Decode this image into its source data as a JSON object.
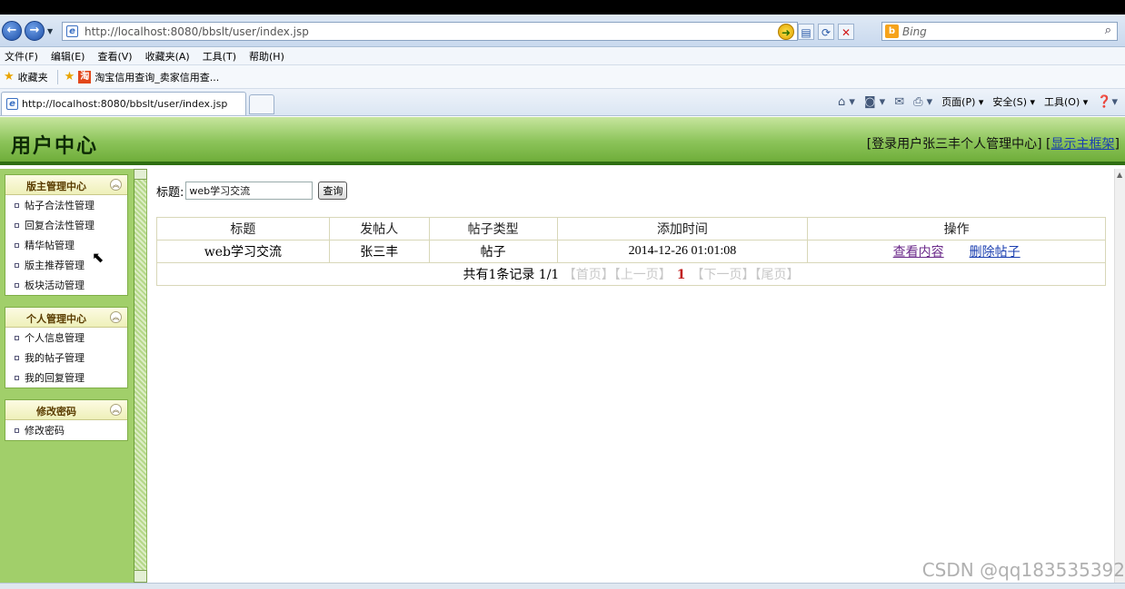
{
  "browser": {
    "url": "http://localhost:8080/bbslt/user/index.jsp",
    "search_provider": "Bing",
    "menu": [
      "文件(F)",
      "编辑(E)",
      "查看(V)",
      "收藏夹(A)",
      "工具(T)",
      "帮助(H)"
    ],
    "favorites_label": "收藏夹",
    "favorite_link": "淘宝信用查询_卖家信用查...",
    "tab_title": "http://localhost:8080/bbslt/user/index.jsp",
    "command_bar": [
      "页面(P) ▾",
      "安全(S) ▾",
      "工具(O) ▾"
    ]
  },
  "header": {
    "title": "用户中心",
    "user_prefix": "[登录用户张三丰个人管理中心] [",
    "show_frame_link": "显示主框架",
    "user_suffix": "]"
  },
  "sidebar": {
    "panels": [
      {
        "title": "版主管理中心",
        "items": [
          "帖子合法性管理",
          "回复合法性管理",
          "精华帖管理",
          "版主推荐管理",
          "板块活动管理"
        ]
      },
      {
        "title": "个人管理中心",
        "items": [
          "个人信息管理",
          "我的帖子管理",
          "我的回复管理"
        ]
      },
      {
        "title": "修改密码",
        "items": [
          "修改密码"
        ]
      }
    ]
  },
  "search": {
    "label": "标题:",
    "value": "web学习交流",
    "button": "查询"
  },
  "table": {
    "headers": [
      "标题",
      "发帖人",
      "帖子类型",
      "添加时间",
      "操作"
    ],
    "rows": [
      {
        "title": "web学习交流",
        "author": "张三丰",
        "type": "帖子",
        "time": "2014-12-26 01:01:08",
        "view": "查看内容",
        "delete": "删除帖子"
      }
    ],
    "pager": {
      "summary": "共有1条记录 1/1",
      "first": "【首页】",
      "prev": "【上一页】",
      "current": "1",
      "next": "【下一页】",
      "last": "【尾页】"
    }
  },
  "watermark": "CSDN @qq183535392"
}
